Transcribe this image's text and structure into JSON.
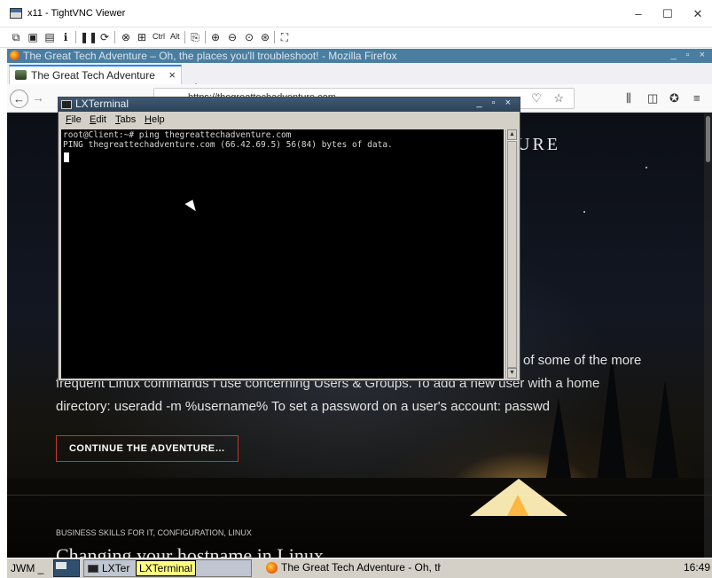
{
  "vnc": {
    "title": "x11 - TightVNC Viewer",
    "controls": {
      "minimize": "–",
      "maximize": "☐",
      "close": "✕"
    },
    "toolbar_ctrl": "Ctrl",
    "toolbar_alt": "Alt"
  },
  "firefox": {
    "window_title": "The Great Tech Adventure – Oh, the places you'll troubleshoot! - Mozilla Firefox",
    "window_controls": "_ ▫ ×",
    "tab_label": "The Great Tech Adventure",
    "tab_close": "×",
    "new_tab": "+",
    "url": "https://thegreattechadventure.com",
    "url_end_icons": "··· ♡ ☆"
  },
  "webpage": {
    "heading_fragment": "URE",
    "line1_fragment": "of some of the more",
    "line2": "frequent Linux commands I use concerning Users & Groups. To add a new user with a home",
    "line3": "directory: useradd -m %username% To set a password on a user's account: passwd",
    "continue_button": "CONTINUE THE ADVENTURE…",
    "post_tags": "BUSINESS SKILLS FOR IT, CONFIGURATION, LINUX",
    "post_title_fragment": "Changing your hostname in Linux"
  },
  "terminal": {
    "title": "LXTerminal",
    "controls": "_ ▫ ×",
    "menu": [
      {
        "accel": "F",
        "rest": "ile"
      },
      {
        "accel": "E",
        "rest": "dit"
      },
      {
        "accel": "T",
        "rest": "abs"
      },
      {
        "accel": "H",
        "rest": "elp"
      }
    ],
    "lines": [
      "root@Client:~# ping thegreattechadventure.com",
      "PING thegreattechadventure.com (66.42.69.5) 56(84) bytes of data."
    ]
  },
  "taskbar": {
    "wm_label": "JWM _",
    "lxterminal_label": "LXTer",
    "tooltip": "LXTerminal",
    "firefox_label": "The Great Tech Adventure - Oh, the places you'll troubleshoot!",
    "clock": "16:49"
  }
}
